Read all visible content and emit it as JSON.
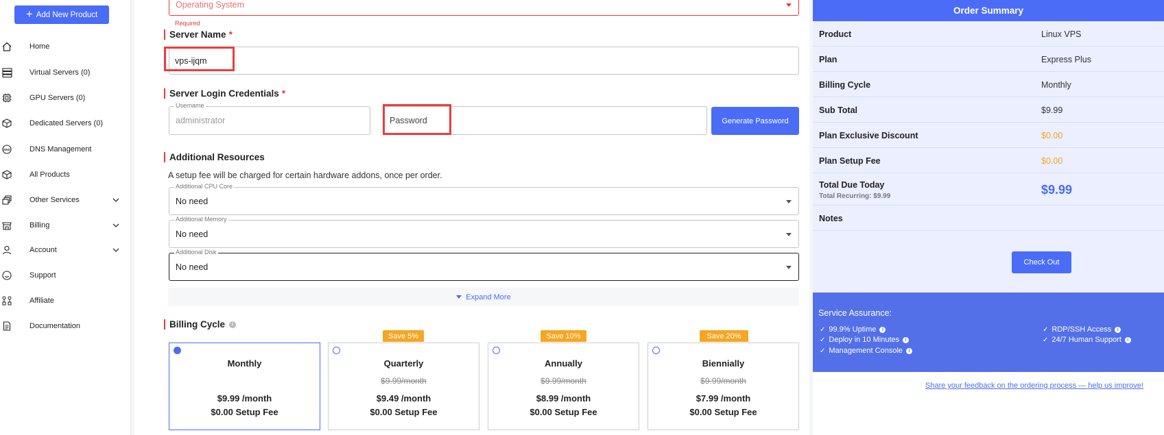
{
  "sidebar": {
    "add_button": "Add New Product",
    "items": [
      {
        "label": "Home",
        "icon": "home-icon"
      },
      {
        "label": "Virtual Servers (0)",
        "icon": "server-icon"
      },
      {
        "label": "GPU Servers (0)",
        "icon": "gpu-icon"
      },
      {
        "label": "Dedicated Servers (0)",
        "icon": "dedicated-server-icon"
      },
      {
        "label": "DNS Management",
        "icon": "dns-icon"
      },
      {
        "label": "All Products",
        "icon": "box-icon"
      },
      {
        "label": "Other Services",
        "icon": "services-icon"
      },
      {
        "label": "Billing",
        "icon": "billing-icon"
      },
      {
        "label": "Account",
        "icon": "account-icon"
      },
      {
        "label": "Support",
        "icon": "support-icon"
      },
      {
        "label": "Affiliate",
        "icon": "affiliate-icon"
      },
      {
        "label": "Documentation",
        "icon": "documentation-icon"
      }
    ]
  },
  "form": {
    "os_placeholder": "Operating System",
    "os_error": "Required",
    "server_name_title": "Server Name",
    "server_name_value": "vps-ijqm",
    "credentials_title": "Server Login Credentials",
    "username_legend": "Username",
    "username_placeholder": "administrator",
    "password_placeholder": "Password",
    "generate_button": "Generate Password",
    "resources_title": "Additional Resources",
    "resources_hint": "A setup fee will be charged for certain hardware addons, once per order.",
    "cpu_legend": "Additional CPU Core",
    "cpu_value": "No need",
    "memory_legend": "Additional Memory",
    "memory_value": "No need",
    "disk_legend": "Additional Disk",
    "disk_value": "No need",
    "expand_more": "Expand More",
    "billing_title": "Billing Cycle",
    "required_mark": "*"
  },
  "billing_cycles": [
    {
      "name": "Monthly",
      "badge": "",
      "original": "",
      "price": "$9.99 /month",
      "setup": "$0.00 Setup Fee",
      "selected": true
    },
    {
      "name": "Quarterly",
      "badge": "Save 5%",
      "original": "$9.99/month",
      "price": "$9.49 /month",
      "setup": "$0.00 Setup Fee",
      "selected": false
    },
    {
      "name": "Annually",
      "badge": "Save 10%",
      "original": "$9.99/month",
      "price": "$8.99 /month",
      "setup": "$0.00 Setup Fee",
      "selected": false
    },
    {
      "name": "Biennially",
      "badge": "Save 20%",
      "original": "$9.99/month",
      "price": "$7.99 /month",
      "setup": "$0.00 Setup Fee",
      "selected": false
    }
  ],
  "summary": {
    "title": "Order Summary",
    "rows": [
      {
        "key": "Product",
        "value": "Linux VPS"
      },
      {
        "key": "Plan",
        "value": "Express Plus"
      },
      {
        "key": "Billing Cycle",
        "value": "Monthly"
      },
      {
        "key": "Sub Total",
        "value": "$9.99"
      },
      {
        "key": "Plan Exclusive Discount",
        "value": "$0.00"
      },
      {
        "key": "Plan Setup Fee",
        "value": "$0.00"
      }
    ],
    "total_label": "Total Due Today",
    "total_recurring": "Total Recurring: $9.99",
    "total_value": "$9.99",
    "notes_label": "Notes",
    "checkout": "Check Out",
    "assurance_title": "Service Assurance:",
    "assurance_left": [
      "99.9% Uptime",
      "Deploy in 10 Minutes",
      "Management Console"
    ],
    "assurance_right": [
      "RDP/SSH Access",
      "24/7 Human Support"
    ],
    "feedback": "Share your feedback on the ordering process — help us improve!"
  },
  "colors": {
    "accent": "#4a6cf7",
    "error": "#e53935",
    "badge": "#f5a623",
    "summary_bg": "#ebefff"
  }
}
